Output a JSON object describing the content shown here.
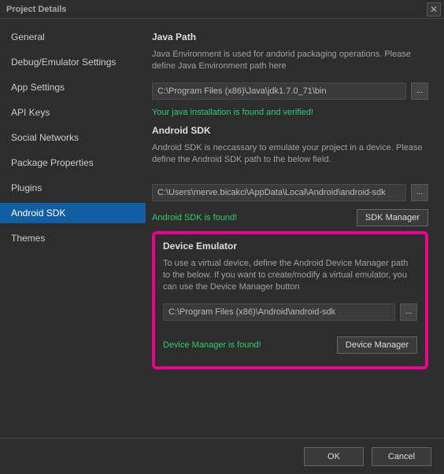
{
  "window": {
    "title": "Project Details"
  },
  "sidebar": {
    "items": [
      {
        "label": "General"
      },
      {
        "label": "Debug/Emulator Settings"
      },
      {
        "label": "App Settings"
      },
      {
        "label": "API Keys"
      },
      {
        "label": "Social Networks"
      },
      {
        "label": "Package Properties"
      },
      {
        "label": "Plugins"
      },
      {
        "label": "Android SDK"
      },
      {
        "label": "Themes"
      }
    ],
    "selected_index": 7
  },
  "javaPath": {
    "heading": "Java Path",
    "desc": "Java Environment is used for andorid packaging operations. Please define Java Environment path here",
    "value": "C:\\Program Files (x86)\\Java\\jdk1.7.0_71\\bin",
    "status": "Your java installation is found and verified!",
    "browse": "..."
  },
  "androidSdk": {
    "heading": "Android SDK",
    "desc": "Android SDK is neccassary to emulate your project in a device. Please define the Android SDK path to the below field.",
    "value": "C:\\Users\\merve.bicakci\\AppData\\Local\\Android\\android-sdk",
    "status": "Android SDK is found!",
    "browse": "...",
    "managerBtn": "SDK Manager"
  },
  "deviceEmulator": {
    "heading": "Device Emulator",
    "desc": "To use a virtual device, define the Android Device Manager path to the below. If you want to create/modify a virtual emulator, you can use the Device Manager button",
    "value": "C:\\Program Files (x86)\\Android\\android-sdk",
    "status": "Device Manager is found!",
    "browse": "...",
    "managerBtn": "Device Manager"
  },
  "buttons": {
    "ok": "OK",
    "cancel": "Cancel"
  }
}
